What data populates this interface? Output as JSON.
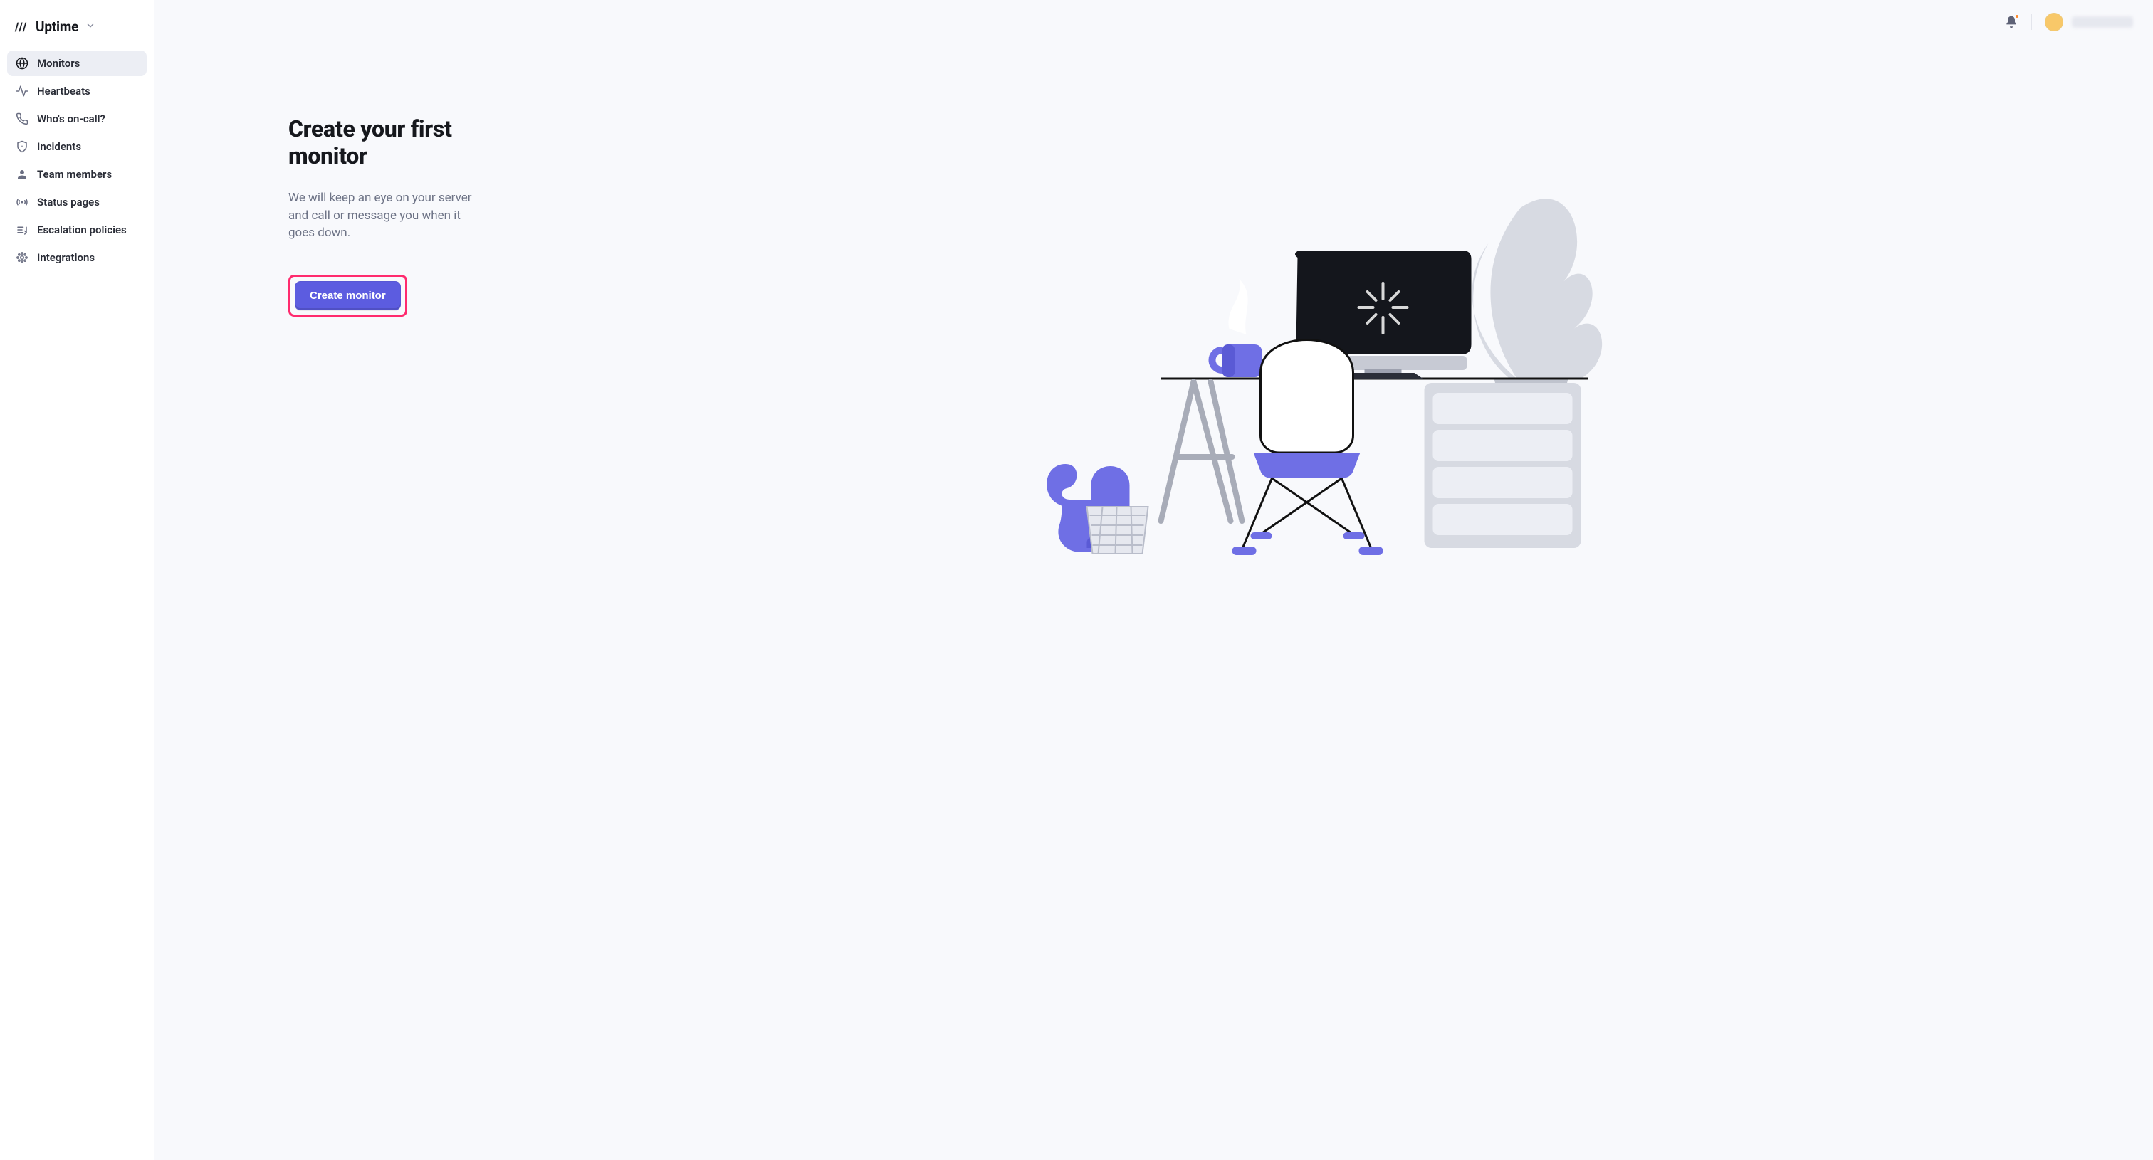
{
  "brand": {
    "name": "Uptime"
  },
  "sidebar": {
    "items": [
      {
        "key": "monitors",
        "label": "Monitors",
        "active": true
      },
      {
        "key": "heartbeats",
        "label": "Heartbeats",
        "active": false
      },
      {
        "key": "oncall",
        "label": "Who's on-call?",
        "active": false
      },
      {
        "key": "incidents",
        "label": "Incidents",
        "active": false
      },
      {
        "key": "team",
        "label": "Team members",
        "active": false
      },
      {
        "key": "status",
        "label": "Status pages",
        "active": false
      },
      {
        "key": "escalation",
        "label": "Escalation policies",
        "active": false
      },
      {
        "key": "integrations",
        "label": "Integrations",
        "active": false
      }
    ]
  },
  "topbar": {
    "notifications_unread": true
  },
  "hero": {
    "title": "Create your first monitor",
    "description": "We will keep an eye on your server and call or message you when it goes down.",
    "cta_label": "Create monitor"
  }
}
